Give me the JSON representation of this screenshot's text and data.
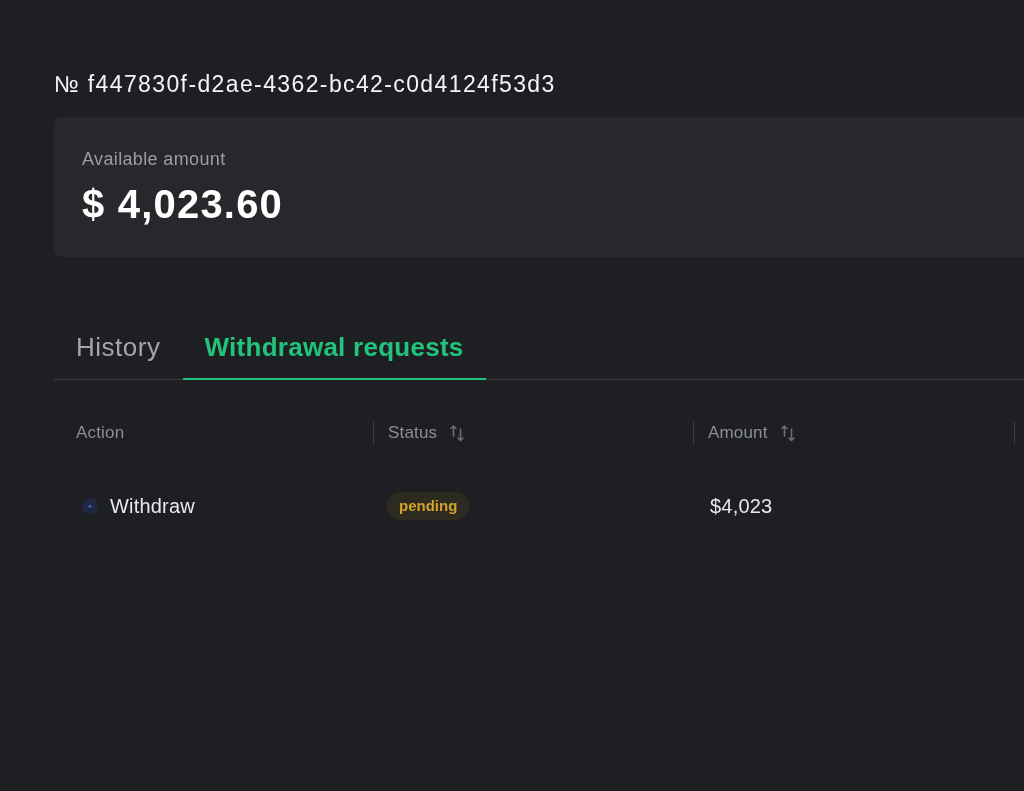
{
  "request_number": "№ f447830f-d2ae-4362-bc42-c0d4124f53d3",
  "balance_card": {
    "label": "Available amount",
    "value": "$ 4,023.60"
  },
  "tabs": [
    {
      "label": "History",
      "selected": false
    },
    {
      "label": "Withdrawal requests",
      "selected": true
    }
  ],
  "table": {
    "columns": [
      {
        "label": "Action",
        "sortable": false
      },
      {
        "label": "Status",
        "sortable": true
      },
      {
        "label": "Amount",
        "sortable": true
      }
    ],
    "rows": [
      {
        "action": {
          "label": "Withdraw",
          "kind": "withdraw"
        },
        "status": {
          "label": "pending",
          "kind": "pending"
        },
        "amount": "$4,023"
      }
    ]
  }
}
